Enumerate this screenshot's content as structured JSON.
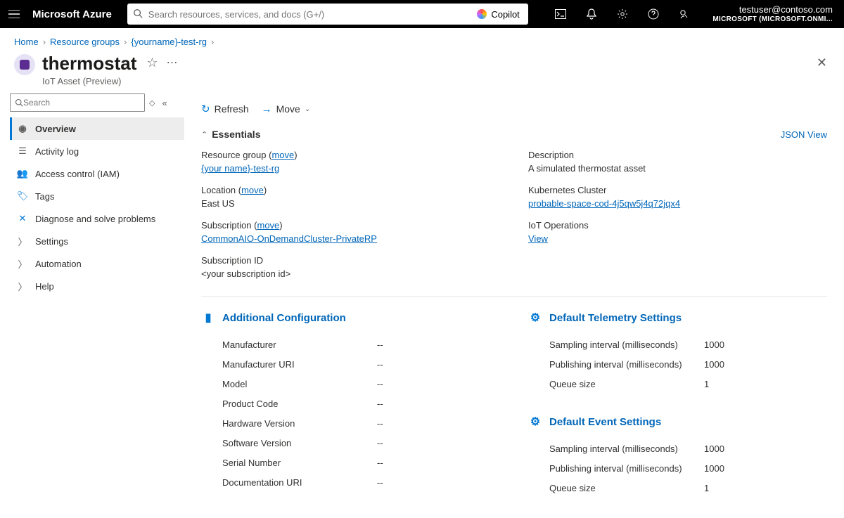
{
  "topbar": {
    "brand": "Microsoft Azure",
    "search_placeholder": "Search resources, services, and docs (G+/)",
    "copilot": "Copilot",
    "account_email": "testuser@contoso.com",
    "tenant": "MICROSOFT (MICROSOFT.ONMI..."
  },
  "breadcrumbs": {
    "home": "Home",
    "rg": "Resource groups",
    "this": "{yourname}-test-rg"
  },
  "header": {
    "title": "thermostat",
    "subtitle": "IoT Asset (Preview)"
  },
  "leftnav": {
    "search_placeholder": "Search",
    "items": [
      {
        "label": "Overview"
      },
      {
        "label": "Activity log"
      },
      {
        "label": "Access control (IAM)"
      },
      {
        "label": "Tags"
      },
      {
        "label": "Diagnose and solve problems"
      },
      {
        "label": "Settings"
      },
      {
        "label": "Automation"
      },
      {
        "label": "Help"
      }
    ]
  },
  "cmdbar": {
    "refresh": "Refresh",
    "move": "Move"
  },
  "essentials": {
    "heading": "Essentials",
    "jsonview": "JSON View",
    "resourcegroup_label": "Resource group (",
    "move": "move",
    "resourcegroup_value": "{your name}-test-rg",
    "location_label": "Location (",
    "location_value": "East US",
    "subscription_label": "Subscription (",
    "subscription_value": "CommonAIO-OnDemandCluster-PrivateRP",
    "subid_label": "Subscription ID",
    "subid_value": "<your subscription id>",
    "description_label": "Description",
    "description_value": "A simulated thermostat asset",
    "k8s_label": "Kubernetes Cluster",
    "k8s_value": "probable-space-cod-4j5qw5j4q72jqx4",
    "iotops_label": "IoT Operations",
    "iotops_value": "View"
  },
  "sections": {
    "additional": {
      "title": "Additional Configuration",
      "rows": [
        {
          "k": "Manufacturer",
          "v": "--"
        },
        {
          "k": "Manufacturer URI",
          "v": "--"
        },
        {
          "k": "Model",
          "v": "--"
        },
        {
          "k": "Product Code",
          "v": "--"
        },
        {
          "k": "Hardware Version",
          "v": "--"
        },
        {
          "k": "Software Version",
          "v": "--"
        },
        {
          "k": "Serial Number",
          "v": "--"
        },
        {
          "k": "Documentation URI",
          "v": "--"
        }
      ]
    },
    "telemetry": {
      "title": "Default Telemetry Settings",
      "rows": [
        {
          "k": "Sampling interval (milliseconds)",
          "v": "1000"
        },
        {
          "k": "Publishing interval (milliseconds)",
          "v": "1000"
        },
        {
          "k": "Queue size",
          "v": "1"
        }
      ]
    },
    "events": {
      "title": "Default Event Settings",
      "rows": [
        {
          "k": "Sampling interval (milliseconds)",
          "v": "1000"
        },
        {
          "k": "Publishing interval (milliseconds)",
          "v": "1000"
        },
        {
          "k": "Queue size",
          "v": "1"
        }
      ]
    }
  }
}
